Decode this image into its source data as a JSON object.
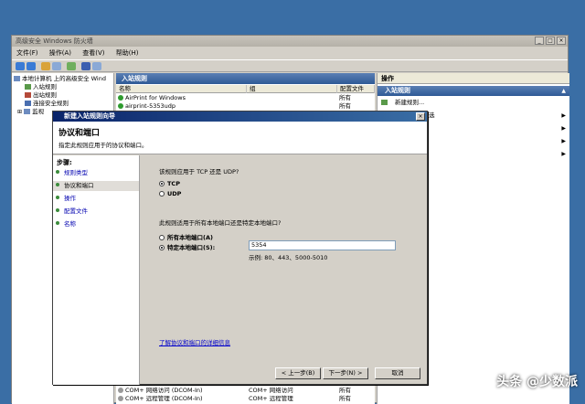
{
  "main_window": {
    "title": "高级安全 Windows 防火墙",
    "menu": [
      "文件(F)",
      "操作(A)",
      "查看(V)",
      "帮助(H)"
    ],
    "tree": [
      "本地计算机 上的高级安全 Wind",
      "入站规则",
      "出站规则",
      "连接安全规则",
      "监视"
    ],
    "middle": {
      "header": "入站规则",
      "columns": [
        "名称",
        "组",
        "配置文件"
      ],
      "rows": [
        {
          "name": "AirPrint for Windows",
          "profile": "所有"
        },
        {
          "name": "airprint-5353udp",
          "profile": "所有"
        },
        {
          "name": "COM+ 网络访问 (DCOM-In)",
          "group": "COM+ 网络访问",
          "profile": "所有"
        },
        {
          "name": "COM+ 远程管理 (DCOM-In)",
          "group": "COM+ 远程管理",
          "profile": "所有"
        }
      ]
    },
    "actions": {
      "header": "操作",
      "subheader": "入站规则",
      "items": [
        "新建规则...",
        "选"
      ]
    }
  },
  "dialog": {
    "title": "新建入站规则向导",
    "heading": "协议和端口",
    "subheading": "指定此规则应用于的协议和端口。",
    "steps_title": "步骤:",
    "steps": [
      "规则类型",
      "协议和端口",
      "操作",
      "配置文件",
      "名称"
    ],
    "current_step": 1,
    "question_protocol": "该规则应用于 TCP 还是 UDP?",
    "protocol_options": [
      "TCP",
      "UDP"
    ],
    "protocol_selected": "TCP",
    "question_ports": "此规则适用于所有本地端口还是特定本地端口?",
    "port_options": [
      "所有本地端口(A)",
      "特定本地端口(S):"
    ],
    "port_selected": "特定本地端口(S):",
    "port_value": "5354",
    "port_example": "示例: 80、443、5000-5010",
    "learn_link": "了解协议和端口的详细信息",
    "buttons": {
      "back": "< 上一步(B)",
      "next": "下一步(N) >",
      "cancel": "取消"
    }
  },
  "watermark": "头条 @少数派",
  "colors": {
    "accent": "#2f5a96",
    "desktop": "#3a6ea5"
  }
}
